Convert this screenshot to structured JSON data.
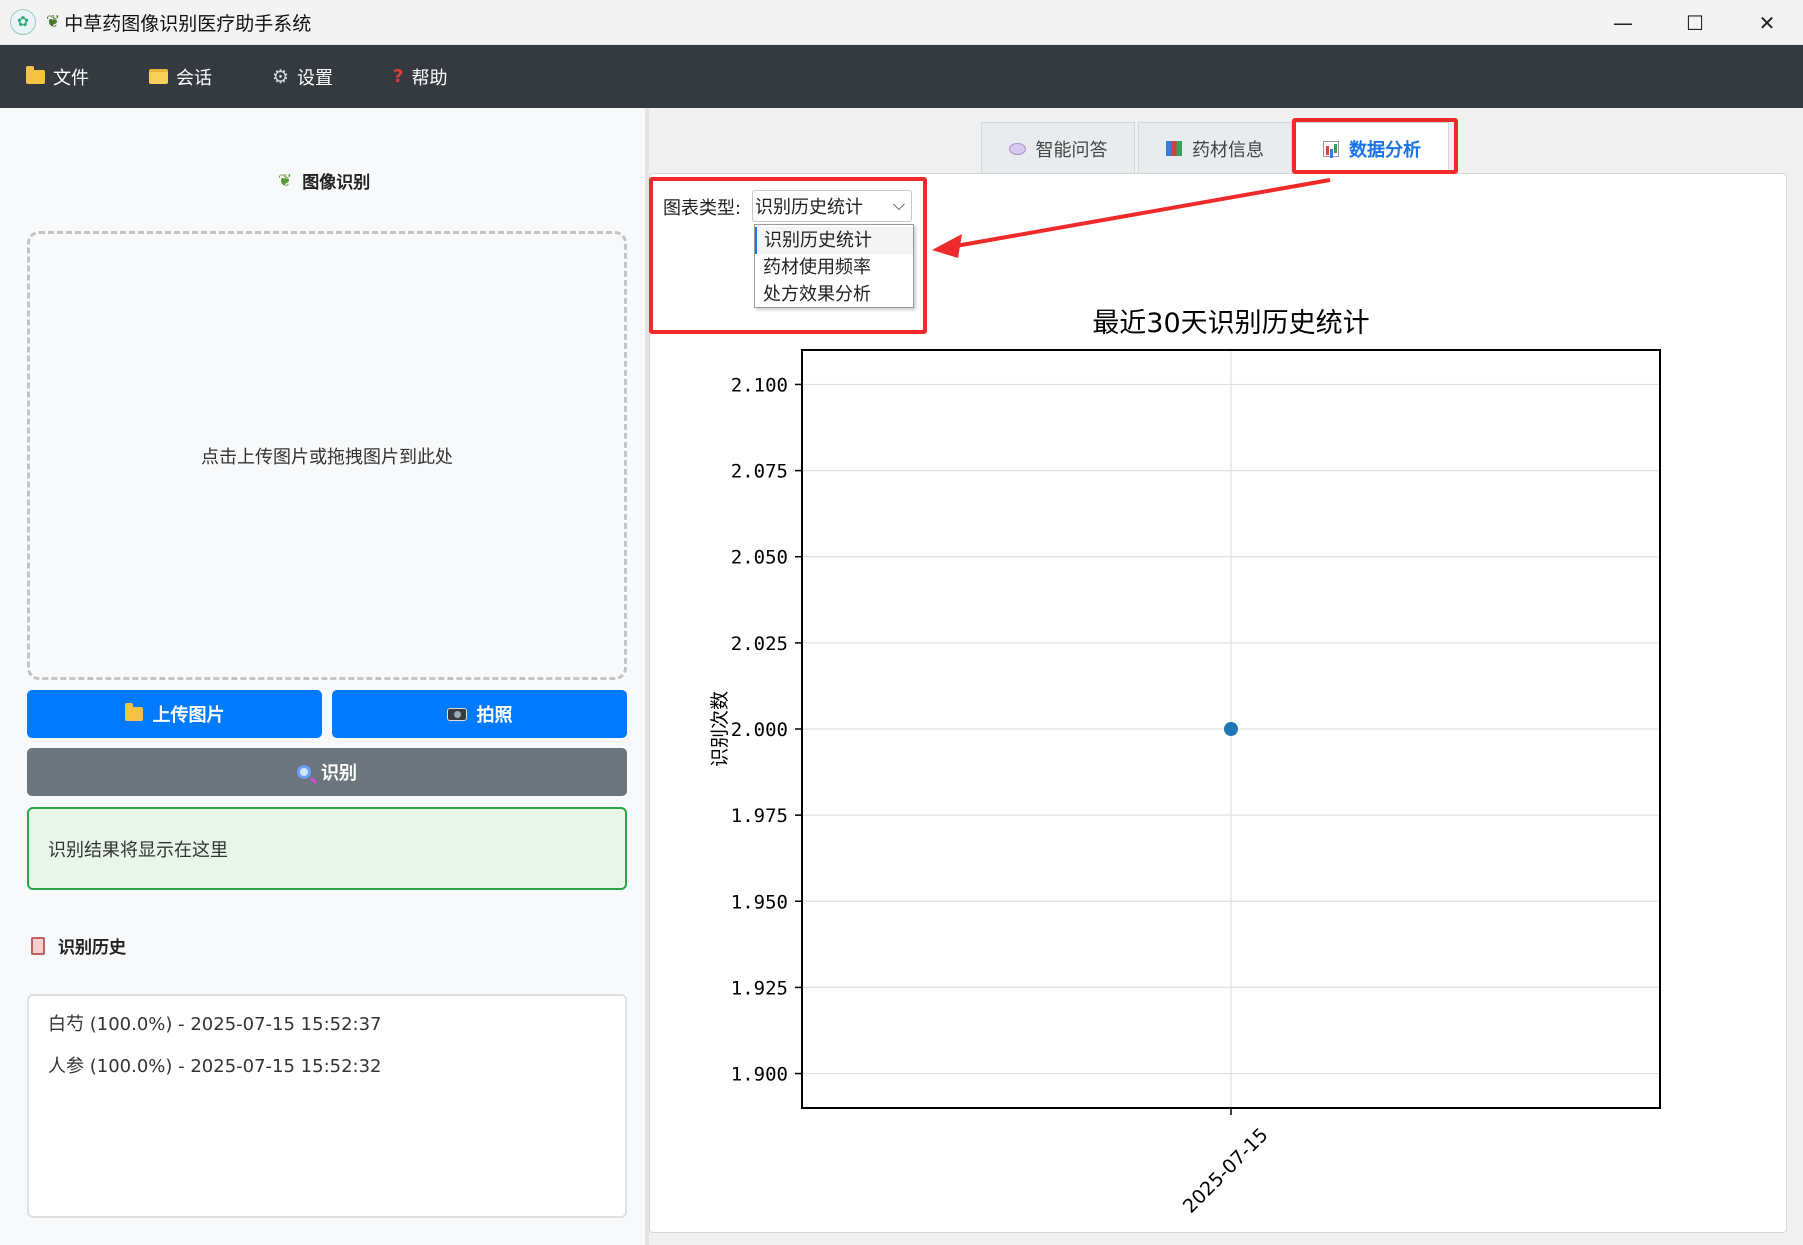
{
  "window": {
    "title": "中草药图像识别医疗助手系统",
    "controls": {
      "minimize": "—",
      "maximize": "☐",
      "close": "✕"
    }
  },
  "menu": {
    "items": [
      {
        "label": "文件",
        "icon": "folder-icon"
      },
      {
        "label": "会话",
        "icon": "folder-open-icon"
      },
      {
        "label": "设置",
        "icon": "gear-icon"
      },
      {
        "label": "帮助",
        "icon": "question-icon"
      }
    ]
  },
  "left": {
    "image_section_title": "图像识别",
    "drop_zone_text": "点击上传图片或拖拽图片到此处",
    "upload_button": "上传图片",
    "camera_button": "拍照",
    "recognize_button": "识别",
    "result_text": "识别结果将显示在这里",
    "history_title": "识别历史",
    "history": [
      "白芍 (100.0%) - 2025-07-15 15:52:37",
      "人参 (100.0%) - 2025-07-15 15:52:32"
    ]
  },
  "tabs": [
    {
      "label": "智能问答",
      "icon": "chat-icon",
      "active": false
    },
    {
      "label": "药材信息",
      "icon": "books-icon",
      "active": false
    },
    {
      "label": "数据分析",
      "icon": "chart-icon",
      "active": true
    }
  ],
  "controls": {
    "chart_type_label": "图表类型:",
    "chart_type_value": "识别历史统计",
    "options": [
      "识别历史统计",
      "药材使用频率",
      "处方效果分析"
    ]
  },
  "colors": {
    "accent": "#007bff",
    "menu_bg": "#343a40",
    "point": "#1f77b4",
    "highlight": "#f02a2a",
    "result_border": "#28a745"
  },
  "chart_data": {
    "type": "scatter",
    "title": "最近30天识别历史统计",
    "ylabel": "识别次数",
    "xlabel": "",
    "x": [
      "2025-07-15"
    ],
    "y": [
      2
    ],
    "ylim": [
      1.89,
      2.11
    ],
    "yticks": [
      "1.900",
      "1.925",
      "1.950",
      "1.975",
      "2.000",
      "2.025",
      "2.050",
      "2.075",
      "2.100"
    ],
    "ytick_values": [
      1.9,
      1.925,
      1.95,
      1.975,
      2.0,
      2.025,
      2.05,
      2.075,
      2.1
    ],
    "grid": true,
    "legend": "none"
  }
}
